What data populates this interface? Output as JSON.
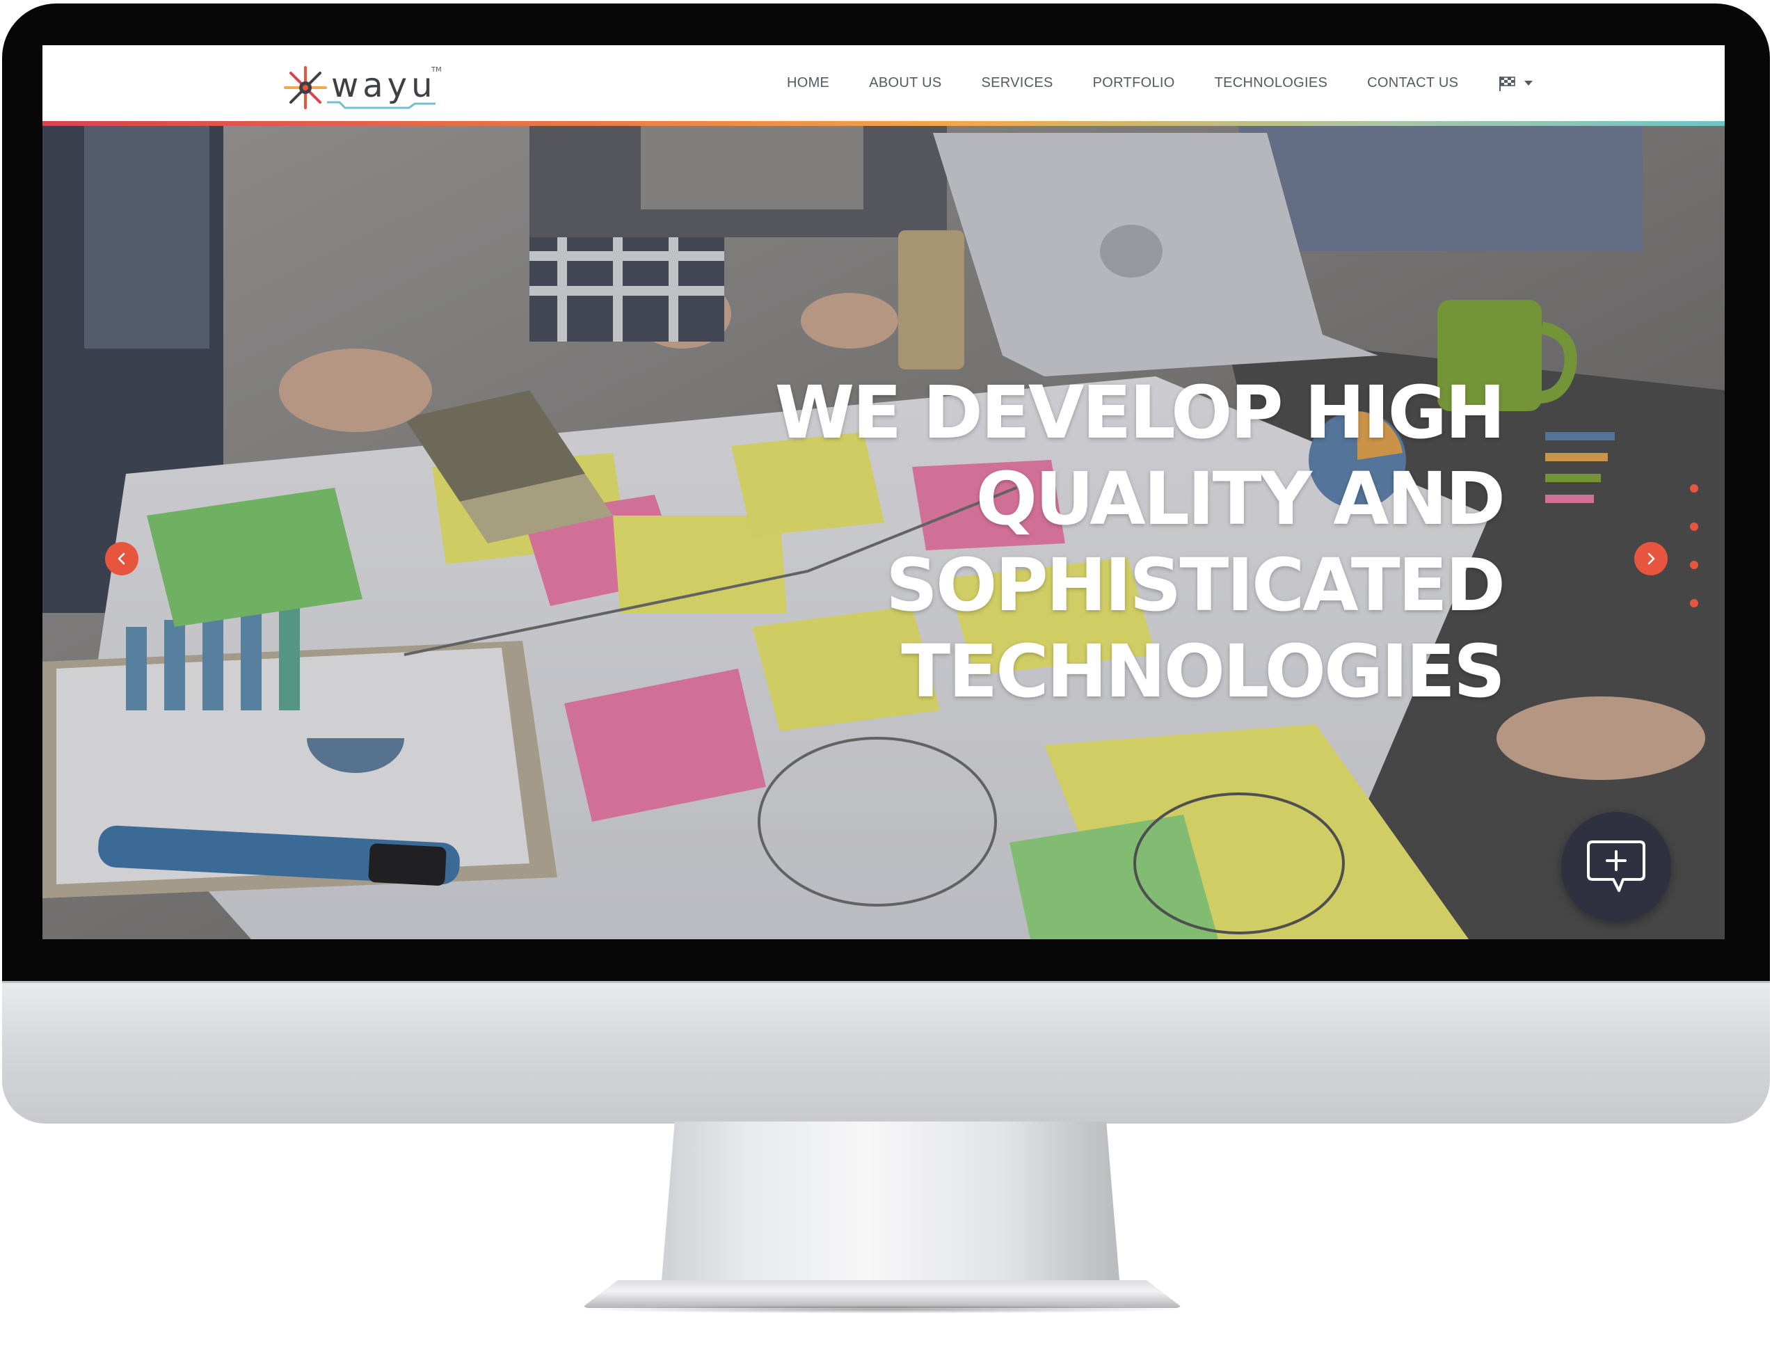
{
  "brand": {
    "logo_text": "wayu",
    "trademark": "TM"
  },
  "nav": {
    "items": [
      {
        "label": "HOME"
      },
      {
        "label": "ABOUT US"
      },
      {
        "label": "SERVICES"
      },
      {
        "label": "PORTFOLIO"
      },
      {
        "label": "TECHNOLOGIES"
      },
      {
        "label": "CONTACT US"
      }
    ],
    "language_icon": "flag-icon",
    "language_caret_icon": "caret-down-icon"
  },
  "hero": {
    "headline_lines": [
      "WE DEVELOP HIGH",
      "QUALITY AND",
      "SOPHISTICATED",
      "TECHNOLOGIES"
    ],
    "prev_icon": "chevron-left-icon",
    "next_icon": "chevron-right-icon",
    "slide_count": 4,
    "active_slide": 1
  },
  "chat": {
    "icon": "chat-plus-icon"
  },
  "colors": {
    "accent": "#e8553f",
    "nav_text": "#555a60",
    "chat_bg": "#2f3040",
    "stripe_start": "#d9434e",
    "stripe_end": "#6fc3c8"
  }
}
